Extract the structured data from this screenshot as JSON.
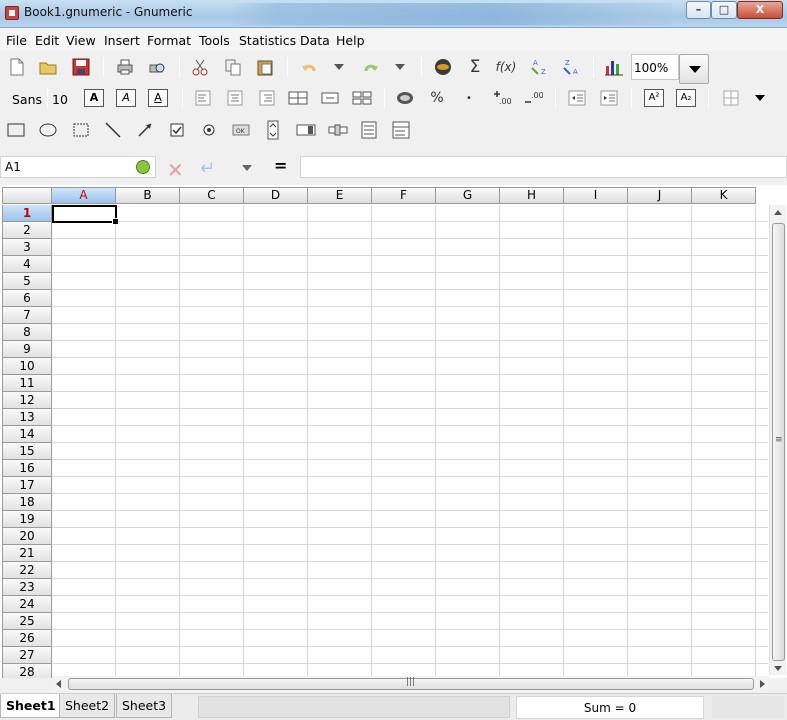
{
  "window": {
    "title": "Book1.gnumeric - Gnumeric",
    "controls": {
      "minimize": "–",
      "maximize": "□",
      "close": "X"
    }
  },
  "menu": [
    "File",
    "Edit",
    "View",
    "Insert",
    "Format",
    "Tools",
    "Statistics",
    "Data",
    "Help"
  ],
  "toolbar_standard": {
    "zoom": "100%",
    "icons": [
      "new-document-icon",
      "open-folder-icon",
      "save-icon",
      "print-icon",
      "print-preview-icon",
      "cut-icon",
      "copy-icon",
      "paste-icon",
      "undo-icon",
      "undo-dropdown-icon",
      "redo-icon",
      "redo-dropdown-icon",
      "hyperlink-globe-icon",
      "sum-icon",
      "function-icon",
      "sort-ascending-icon",
      "sort-descending-icon",
      "chart-icon"
    ]
  },
  "toolbar_format": {
    "font_name": "Sans",
    "font_size": "10",
    "bold": "A",
    "italic": "A",
    "underline": "A",
    "superscript": "A²",
    "subscript": "A₂",
    "percent": "%",
    "thousands": "•"
  },
  "formula_bar": {
    "cell_ref": "A1",
    "equals": "=",
    "formula": ""
  },
  "grid": {
    "columns": [
      "A",
      "B",
      "C",
      "D",
      "E",
      "F",
      "G",
      "H",
      "I",
      "J",
      "K"
    ],
    "rows": [
      "1",
      "2",
      "3",
      "4",
      "5",
      "6",
      "7",
      "8",
      "9",
      "10",
      "11",
      "12",
      "13",
      "14",
      "15",
      "16",
      "17",
      "18",
      "19",
      "20",
      "21",
      "22",
      "23",
      "24",
      "25",
      "26",
      "27",
      "28"
    ],
    "active_column": "A",
    "active_row": "1"
  },
  "sheets": [
    "Sheet1",
    "Sheet2",
    "Sheet3"
  ],
  "status": {
    "sum": "Sum = 0"
  },
  "colors": {
    "accent_red": "#c00000",
    "active_header": "#9ec3ec"
  }
}
